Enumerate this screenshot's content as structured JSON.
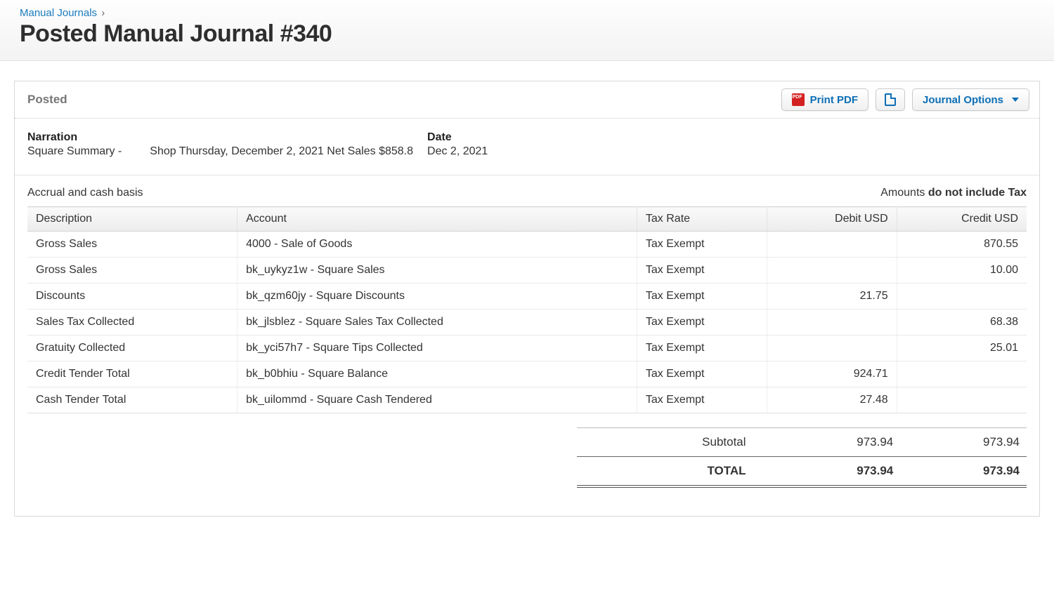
{
  "breadcrumb": {
    "parent": "Manual Journals",
    "sep": "›"
  },
  "page_title": "Posted Manual Journal #340",
  "panel": {
    "status": "Posted",
    "actions": {
      "print_pdf": "Print PDF",
      "journal_options": "Journal Options"
    }
  },
  "meta": {
    "narration_label": "Narration",
    "narration_prefix": "Square Summary -",
    "narration_detail": "Shop Thursday, December 2, 2021 Net Sales $858.8",
    "date_label": "Date",
    "date_value": "Dec 2, 2021"
  },
  "basis": "Accrual and cash basis",
  "tax_note_prefix": "Amounts ",
  "tax_note_bold": "do not include Tax",
  "columns": {
    "description": "Description",
    "account": "Account",
    "tax_rate": "Tax Rate",
    "debit": "Debit USD",
    "credit": "Credit USD"
  },
  "lines": [
    {
      "description": "Gross Sales",
      "account": "4000 - Sale of Goods",
      "tax_rate": "Tax Exempt",
      "debit": "",
      "credit": "870.55"
    },
    {
      "description": "Gross Sales",
      "account": "bk_uykyz1w - Square Sales",
      "tax_rate": "Tax Exempt",
      "debit": "",
      "credit": "10.00"
    },
    {
      "description": "Discounts",
      "account": "bk_qzm60jy - Square Discounts",
      "tax_rate": "Tax Exempt",
      "debit": "21.75",
      "credit": ""
    },
    {
      "description": "Sales Tax Collected",
      "account": "bk_jlsblez - Square Sales Tax Collected",
      "tax_rate": "Tax Exempt",
      "debit": "",
      "credit": "68.38"
    },
    {
      "description": "Gratuity Collected",
      "account": "bk_yci57h7 - Square Tips Collected",
      "tax_rate": "Tax Exempt",
      "debit": "",
      "credit": "25.01"
    },
    {
      "description": "Credit Tender Total",
      "account": "bk_b0bhiu - Square Balance",
      "tax_rate": "Tax Exempt",
      "debit": "924.71",
      "credit": ""
    },
    {
      "description": "Cash Tender Total",
      "account": "bk_uilommd - Square Cash Tendered",
      "tax_rate": "Tax Exempt",
      "debit": "27.48",
      "credit": ""
    }
  ],
  "totals": {
    "subtotal_label": "Subtotal",
    "subtotal_debit": "973.94",
    "subtotal_credit": "973.94",
    "total_label": "TOTAL",
    "total_debit": "973.94",
    "total_credit": "973.94"
  }
}
